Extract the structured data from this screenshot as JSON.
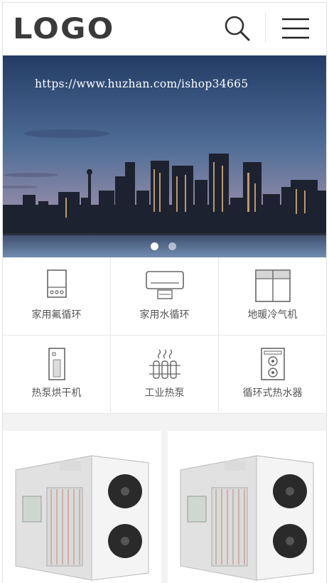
{
  "header": {
    "logo_text": "LOGO",
    "search_icon": "search-icon",
    "menu_icon": "hamburger-menu-icon"
  },
  "banner": {
    "watermark_text": "https://www.huzhan.com/ishop34665",
    "slide_count": 2,
    "active_slide": 1
  },
  "categories": [
    {
      "label": "家用氟循环",
      "icon": "water-heater-icon"
    },
    {
      "label": "家用水循环",
      "icon": "air-conditioner-icon"
    },
    {
      "label": "地暖冷气机",
      "icon": "cabinet-unit-icon"
    },
    {
      "label": "热泵烘干机",
      "icon": "dryer-icon"
    },
    {
      "label": "工业热泵",
      "icon": "radiator-icon"
    },
    {
      "label": "循环式热水器",
      "icon": "speaker-unit-icon"
    }
  ],
  "products": [
    {
      "image": "heat-pump-unit-image"
    },
    {
      "image": "heat-pump-unit-image"
    }
  ],
  "colors": {
    "text_primary": "#3a3a3a",
    "text_label": "#555555",
    "divider": "#e7e7e7",
    "background_gray": "#f3f3f3"
  }
}
